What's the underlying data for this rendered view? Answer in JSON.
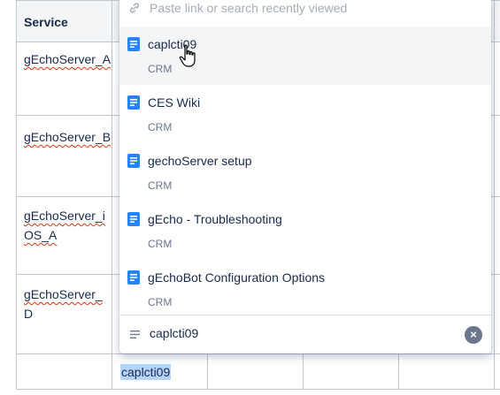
{
  "table": {
    "header": "Service",
    "rows": [
      {
        "line1": "gEchoServer_A",
        "line2": ""
      },
      {
        "line1": "gEchoServer_B",
        "line2": ""
      },
      {
        "line1": "gEchoServer_i",
        "line2": "OS_A"
      },
      {
        "line1": "gEchoServer_",
        "line2": "D"
      }
    ],
    "bottom_cell_text": "caplcti09"
  },
  "dropdown": {
    "search_placeholder": "Paste link or search recently viewed",
    "items": [
      {
        "title": "caplcti09",
        "space": "CRM",
        "icon": "document-icon",
        "active": true
      },
      {
        "title": "CES Wiki",
        "space": "CRM",
        "icon": "document-icon"
      },
      {
        "title": "gechoServer setup",
        "space": "CRM",
        "icon": "document-icon"
      },
      {
        "title": "gEcho - Troubleshooting",
        "space": "CRM",
        "icon": "document-icon"
      },
      {
        "title": "gEchoBot Configuration Options",
        "space": "CRM",
        "icon": "document-icon"
      }
    ],
    "footer": {
      "query": "caplcti09",
      "icon": "text-lines-icon"
    }
  },
  "colors": {
    "accent": "#2684ff",
    "selection": "#b3d4ff",
    "muted": "#6b778c"
  }
}
